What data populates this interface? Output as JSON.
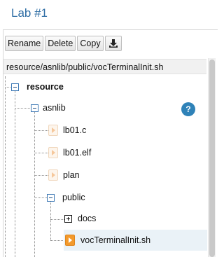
{
  "app": {
    "title": "Lab #1"
  },
  "toolbar": {
    "rename_label": "Rename",
    "delete_label": "Delete",
    "copy_label": "Copy",
    "download_icon": "download-icon"
  },
  "pathbar": {
    "path": "resource/asnlib/public/vocTerminalInit.sh"
  },
  "help": {
    "label": "?"
  },
  "tree": {
    "root": {
      "label": "resource",
      "expanded": true
    },
    "asnlib": {
      "label": "asnlib",
      "expanded": true
    },
    "files_asnlib": [
      {
        "label": "lb01.c"
      },
      {
        "label": "lb01.elf"
      },
      {
        "label": "plan"
      }
    ],
    "public": {
      "label": "public",
      "expanded": true
    },
    "docs": {
      "label": "docs",
      "expanded": false
    },
    "selected_file": {
      "label": "vocTerminalInit.sh",
      "selected": true
    }
  },
  "colors": {
    "title": "#2e6da4",
    "tree_box_border": "#3c78b5",
    "file_icon_active": "#f39a2c",
    "help_badge": "#2f82b8",
    "selected_row": "#eaf2f7"
  }
}
